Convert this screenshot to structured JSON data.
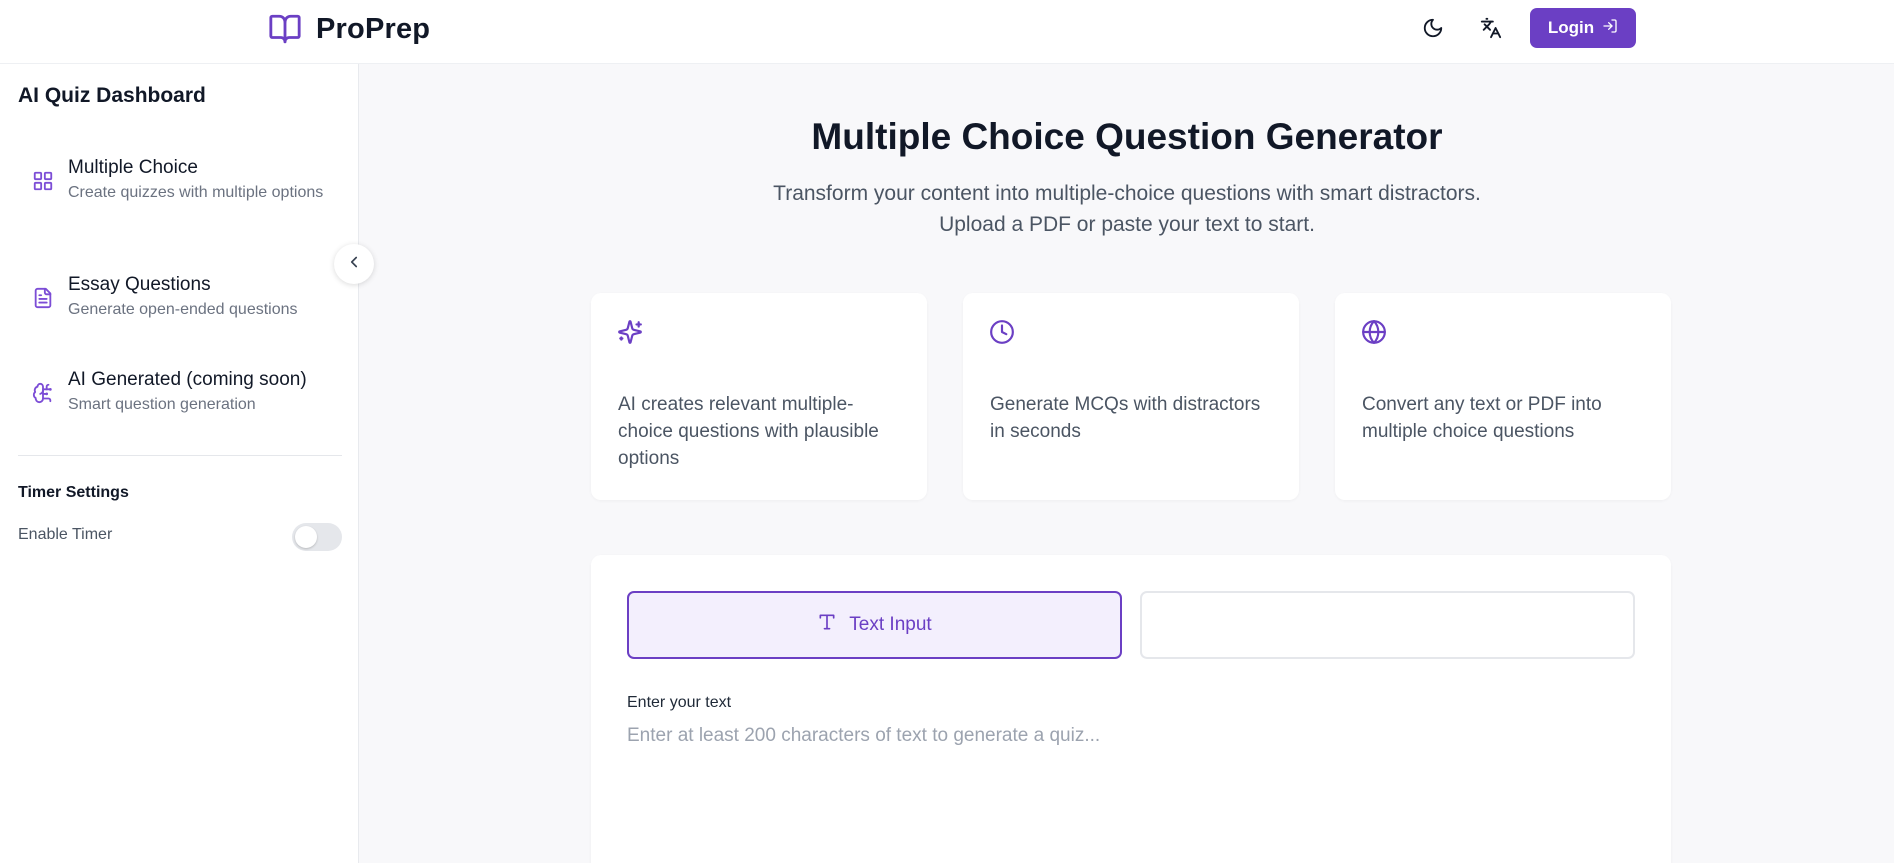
{
  "header": {
    "brand_name": "ProPrep",
    "brand_icon": "open-book-icon",
    "theme_icon": "moon-icon",
    "language_icon": "translate-icon",
    "login_label": "Login",
    "login_icon": "sign-in-icon",
    "accent_color": "#6b3fc4"
  },
  "sidebar": {
    "title": "AI Quiz Dashboard",
    "items": [
      {
        "label": "Multiple Choice",
        "description": "Create quizzes with multiple options",
        "icon": "grid-icon"
      },
      {
        "label": "Essay Questions",
        "description": "Generate open-ended questions",
        "icon": "document-icon"
      },
      {
        "label": "AI Generated (coming soon)",
        "description": "Smart question generation",
        "icon": "brain-icon"
      }
    ],
    "timer": {
      "title": "Timer Settings",
      "enable_label": "Enable Timer",
      "enabled": false
    },
    "collapse_icon": "chevron-left-icon"
  },
  "main": {
    "title": "Multiple Choice Question Generator",
    "subtitle_line1": "Transform your content into multiple-choice questions with smart distractors.",
    "subtitle_line2": "Upload a PDF or paste your text to start.",
    "features": [
      {
        "icon": "sparkles-icon",
        "text": "AI creates relevant multiple-choice questions with plausible options"
      },
      {
        "icon": "clock-icon",
        "text": "Generate MCQs with distractors in seconds"
      },
      {
        "icon": "globe-icon",
        "text": "Convert any text or PDF into multiple choice questions"
      }
    ],
    "tabs": [
      {
        "label": "Text Input",
        "icon": "text-icon",
        "active": true
      },
      {
        "label": "",
        "active": false
      }
    ],
    "input_label": "Enter your text",
    "input_placeholder": "Enter at least 200 characters of text to generate a quiz..."
  }
}
